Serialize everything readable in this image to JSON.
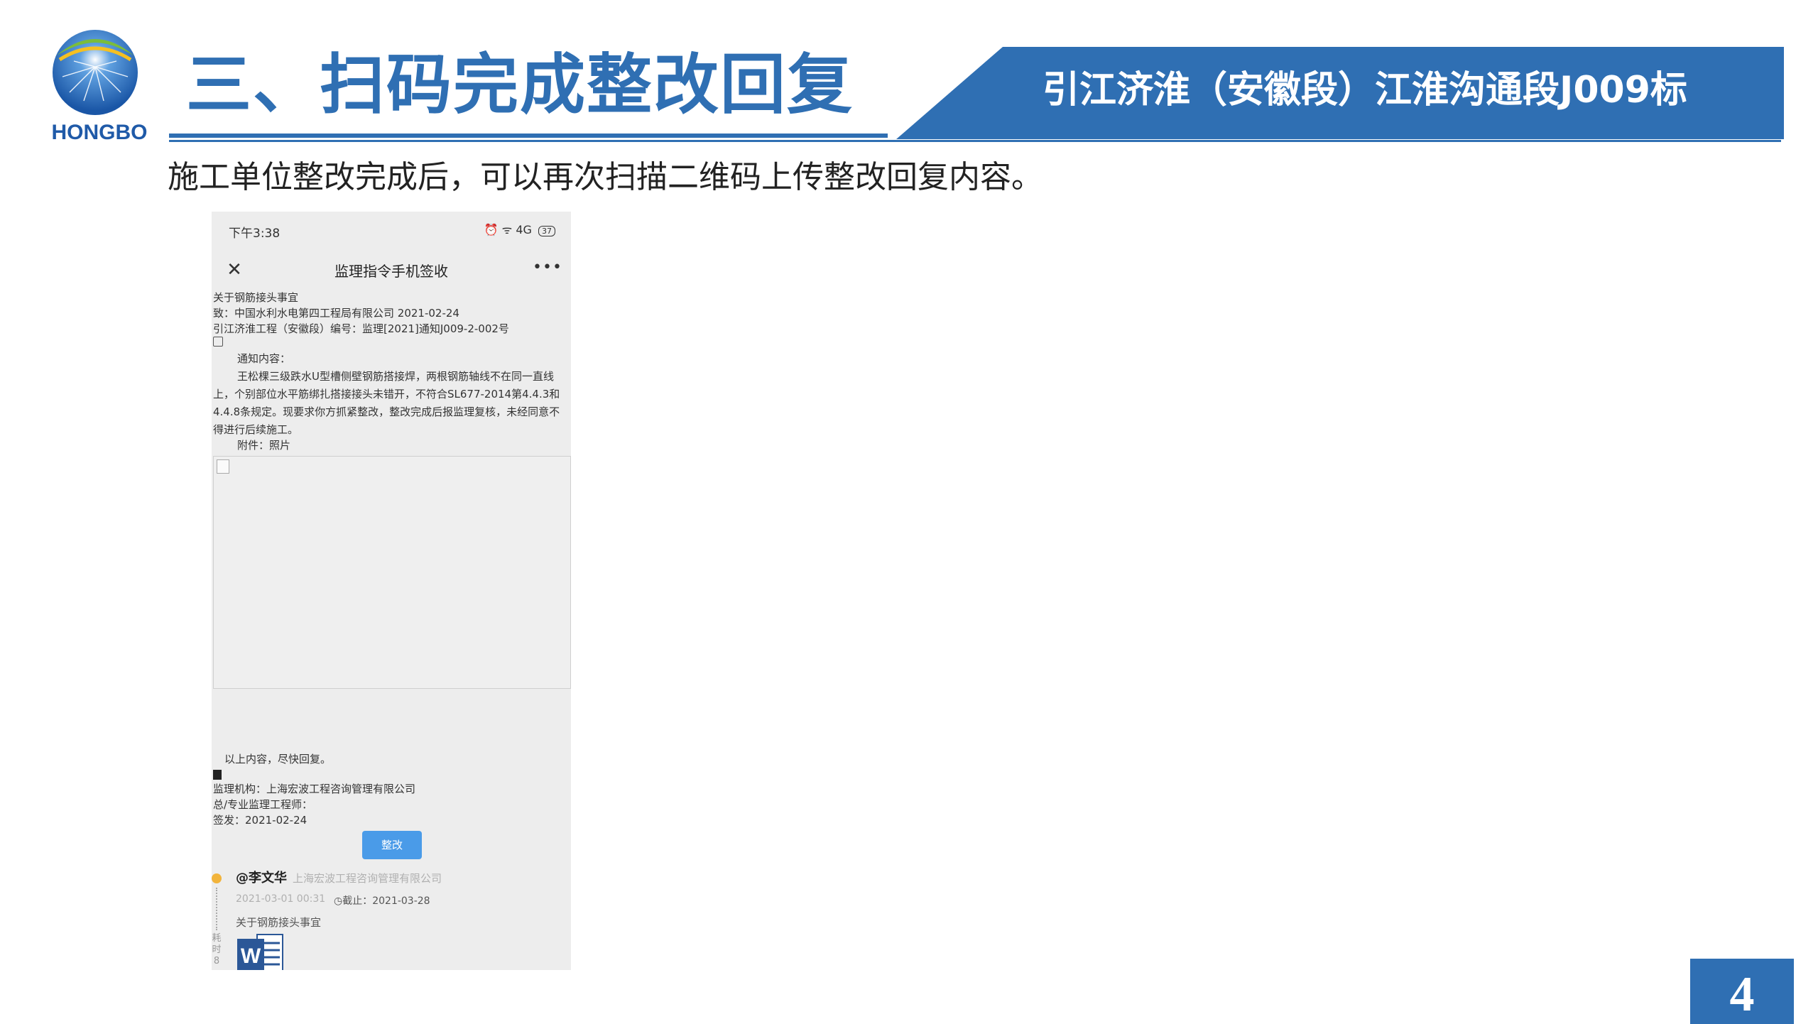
{
  "header": {
    "logo_text": "HONGBO",
    "title": "三、扫码完成整改回复",
    "project_banner": "引江济淮（安徽段）江淮沟通段J009标"
  },
  "instruction": "施工单位整改完成后，可以再次扫描二维码上传整改回复内容。",
  "phone": {
    "status_bar": {
      "time": "下午3:38",
      "icons_text": "⏰ ᯤ 4G",
      "battery": "37"
    },
    "nav": {
      "close_icon": "close-icon",
      "title": "监理指令手机签收",
      "more_icon": "more-icon"
    },
    "message": {
      "subject": "关于钢筋接头事宜",
      "to_line": "致：中国水利水电第四工程局有限公司 2021-02-24",
      "project_line": "引江济淮工程（安徽段）编号：监理[2021]通知J009-2-002号",
      "notice_label": "通知内容：",
      "body": "王松棵三级跌水U型槽侧壁钢筋搭接焊，两根钢筋轴线不在同一直线上，个别部位水平筋绑扎搭接接头未错开，不符合SL677-2014第4.4.3和4.4.8条规定。现要求你方抓紧整改，整改完成后报监理复核，未经同意不得进行后续施工。",
      "attachment_label": "附件：照片",
      "closing": "以上内容，尽快回复。",
      "supervisor_org": "监理机构：上海宏波工程咨询管理有限公司",
      "engineer_label": "总/专业监理工程师：",
      "issue_date": "签发：2021-02-24",
      "rectify_button": "整改"
    },
    "reply": {
      "user": "@李文华",
      "org": "上海宏波工程咨询管理有限公司",
      "timestamp": "2021-03-01 00:31",
      "deadline": "截止：2021-03-28",
      "subject": "关于钢筋接头事宜",
      "elapsed_label": "耗时8",
      "attachment_icon": "word-document-icon"
    }
  },
  "page_number": "4",
  "colors": {
    "brand_blue": "#2f6fb3",
    "button_blue": "#4a9be8",
    "timeline_dot": "#f2b43c"
  }
}
